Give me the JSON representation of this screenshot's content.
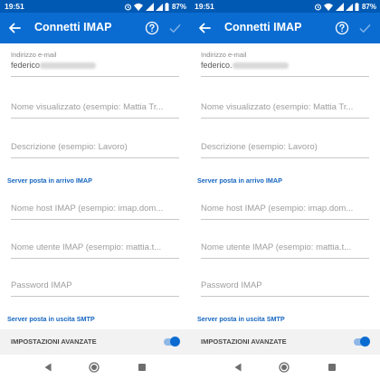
{
  "screens": [
    {
      "status": {
        "time": "19:51",
        "battery": "87%",
        "network": "4G+"
      },
      "appbar": {
        "title": "Connetti IMAP"
      },
      "fields": [
        {
          "label": "Indirizzo e-mail",
          "value_prefix": "federico"
        },
        {
          "placeholder": "Nome visualizzato (esempio: Mattia Tr..."
        },
        {
          "placeholder": "Descrizione (esempio: Lavoro)"
        },
        {
          "placeholder": "Nome host IMAP (esempio: imap.dom..."
        },
        {
          "placeholder": "Nome utente IMAP (esempio: mattia.t..."
        },
        {
          "placeholder": "Password IMAP"
        }
      ],
      "sections": {
        "incoming": "Server posta in arrivo IMAP",
        "outgoing": "Server posta in uscita SMTP"
      },
      "advanced": {
        "label": "IMPOSTAZIONI AVANZATE",
        "enabled": true
      }
    },
    {
      "status": {
        "time": "19:51",
        "battery": "87%",
        "network": "4G+"
      },
      "appbar": {
        "title": "Connetti IMAP"
      },
      "fields": [
        {
          "label": "Indirizzo e-mail",
          "value_prefix": "federico."
        },
        {
          "placeholder": "Nome visualizzato (esempio: Mattia Tr..."
        },
        {
          "placeholder": "Descrizione (esempio: Lavoro)"
        },
        {
          "placeholder": "Nome host IMAP (esempio: imap.dom..."
        },
        {
          "placeholder": "Nome utente IMAP (esempio: mattia.t..."
        },
        {
          "placeholder": "Password IMAP"
        }
      ],
      "sections": {
        "incoming": "Server posta in arrivo IMAP",
        "outgoing": "Server posta in uscita SMTP"
      },
      "advanced": {
        "label": "IMPOSTAZIONI AVANZATE",
        "enabled": true
      }
    }
  ],
  "colors": {
    "status_bar": "#0059b3",
    "app_bar": "#0a6cd1",
    "accent": "#1666c1",
    "toggle_on": "#0a6cd1"
  },
  "icons": {
    "back": "arrow-left-icon",
    "help": "help-circle-icon",
    "confirm": "check-icon",
    "nav_back": "triangle-back-icon",
    "nav_home": "circle-home-icon",
    "nav_recent": "square-recent-icon"
  }
}
